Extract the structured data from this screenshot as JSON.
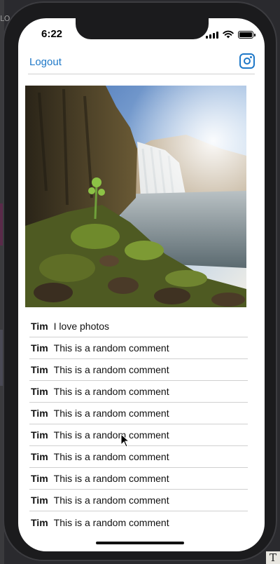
{
  "status": {
    "time": "6:22"
  },
  "nav": {
    "logout_label": "Logout"
  },
  "post": {
    "comments": [
      {
        "user": "Tim",
        "text": "I love photos"
      },
      {
        "user": "Tim",
        "text": "This is a random comment"
      },
      {
        "user": "Tim",
        "text": "This is a random comment"
      },
      {
        "user": "Tim",
        "text": "This is a random comment"
      },
      {
        "user": "Tim",
        "text": "This is a random comment"
      },
      {
        "user": "Tim",
        "text": "This is a random comment"
      },
      {
        "user": "Tim",
        "text": "This is a random comment"
      },
      {
        "user": "Tim",
        "text": "This is a random comment"
      },
      {
        "user": "Tim",
        "text": "This is a random comment"
      },
      {
        "user": "Tim",
        "text": "This is a random comment"
      }
    ]
  },
  "desktop": {
    "corner_glyph": "T",
    "top_left_text": "LO"
  },
  "colors": {
    "accent": "#1e78c8"
  }
}
